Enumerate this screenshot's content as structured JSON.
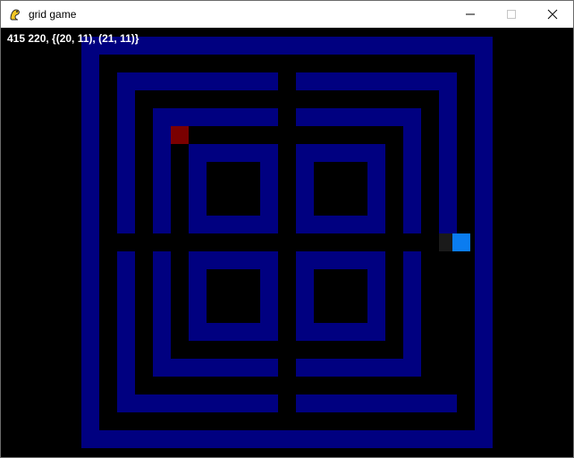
{
  "window": {
    "title": "grid game",
    "minimize_glyph": "—",
    "maximize_glyph": "☐",
    "close_glyph": "✕"
  },
  "debug_text": "415 220, {(20, 11), (21, 11)}",
  "colors": {
    "wall": "#000080",
    "floor": "#000000",
    "player": "#0a7cf0",
    "enemy": "#7a0000",
    "trail": "#1a1a1a"
  },
  "icons": {
    "app": "pygame-snake-icon"
  }
}
